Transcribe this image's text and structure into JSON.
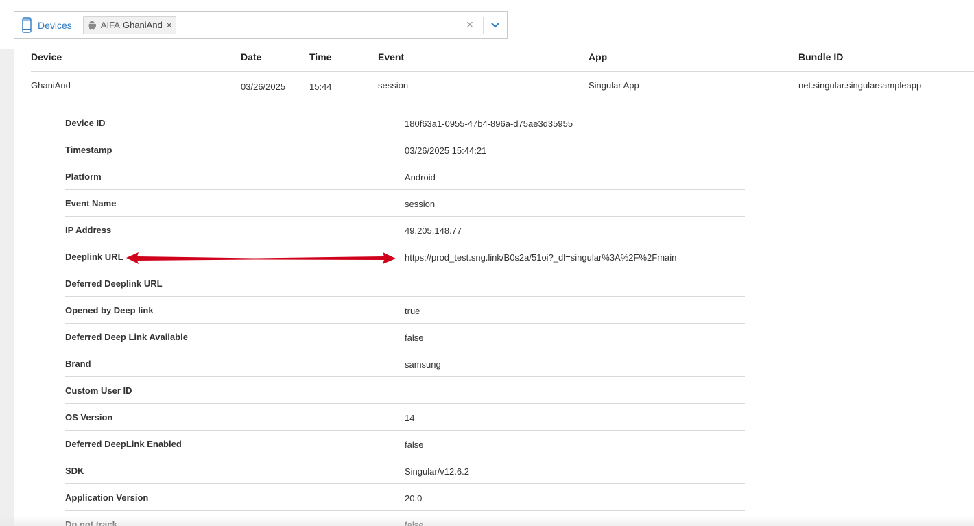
{
  "filter": {
    "label": "Devices",
    "chip": {
      "prefix": "AIFA",
      "name": "GhaniAnd",
      "remove": "×"
    },
    "clear": "×"
  },
  "table": {
    "headers": [
      "Device",
      "Date",
      "Time",
      "Event",
      "App",
      "Bundle ID"
    ],
    "row": [
      "GhaniAnd",
      "03/26/2025",
      "15:44",
      "session",
      "Singular App",
      "net.singular.singularsampleapp"
    ]
  },
  "details": [
    {
      "key": "Device ID",
      "value": "180f63a1-0955-47b4-896a-d75ae3d35955"
    },
    {
      "key": "Timestamp",
      "value": "03/26/2025 15:44:21"
    },
    {
      "key": "Platform",
      "value": "Android"
    },
    {
      "key": "Event Name",
      "value": "session"
    },
    {
      "key": "IP Address",
      "value": "49.205.148.77"
    },
    {
      "key": "Deeplink URL",
      "value": "https://prod_test.sng.link/B0s2a/51oi?_dl=singular%3A%2F%2Fmain"
    },
    {
      "key": "Deferred Deeplink URL",
      "value": ""
    },
    {
      "key": "Opened by Deep link",
      "value": "true"
    },
    {
      "key": "Deferred Deep Link Available",
      "value": "false"
    },
    {
      "key": "Brand",
      "value": "samsung"
    },
    {
      "key": "Custom User ID",
      "value": ""
    },
    {
      "key": "OS Version",
      "value": "14"
    },
    {
      "key": "Deferred DeepLink Enabled",
      "value": "false"
    },
    {
      "key": "SDK",
      "value": "Singular/v12.6.2"
    },
    {
      "key": "Application Version",
      "value": "20.0"
    },
    {
      "key": "Do not track",
      "value": "false"
    }
  ],
  "colors": {
    "accent": "#2f7cc1",
    "annotation_arrow": "#d0021b"
  },
  "icons": [
    "phone-icon",
    "android-icon",
    "chevron-down-icon",
    "close-icon"
  ]
}
